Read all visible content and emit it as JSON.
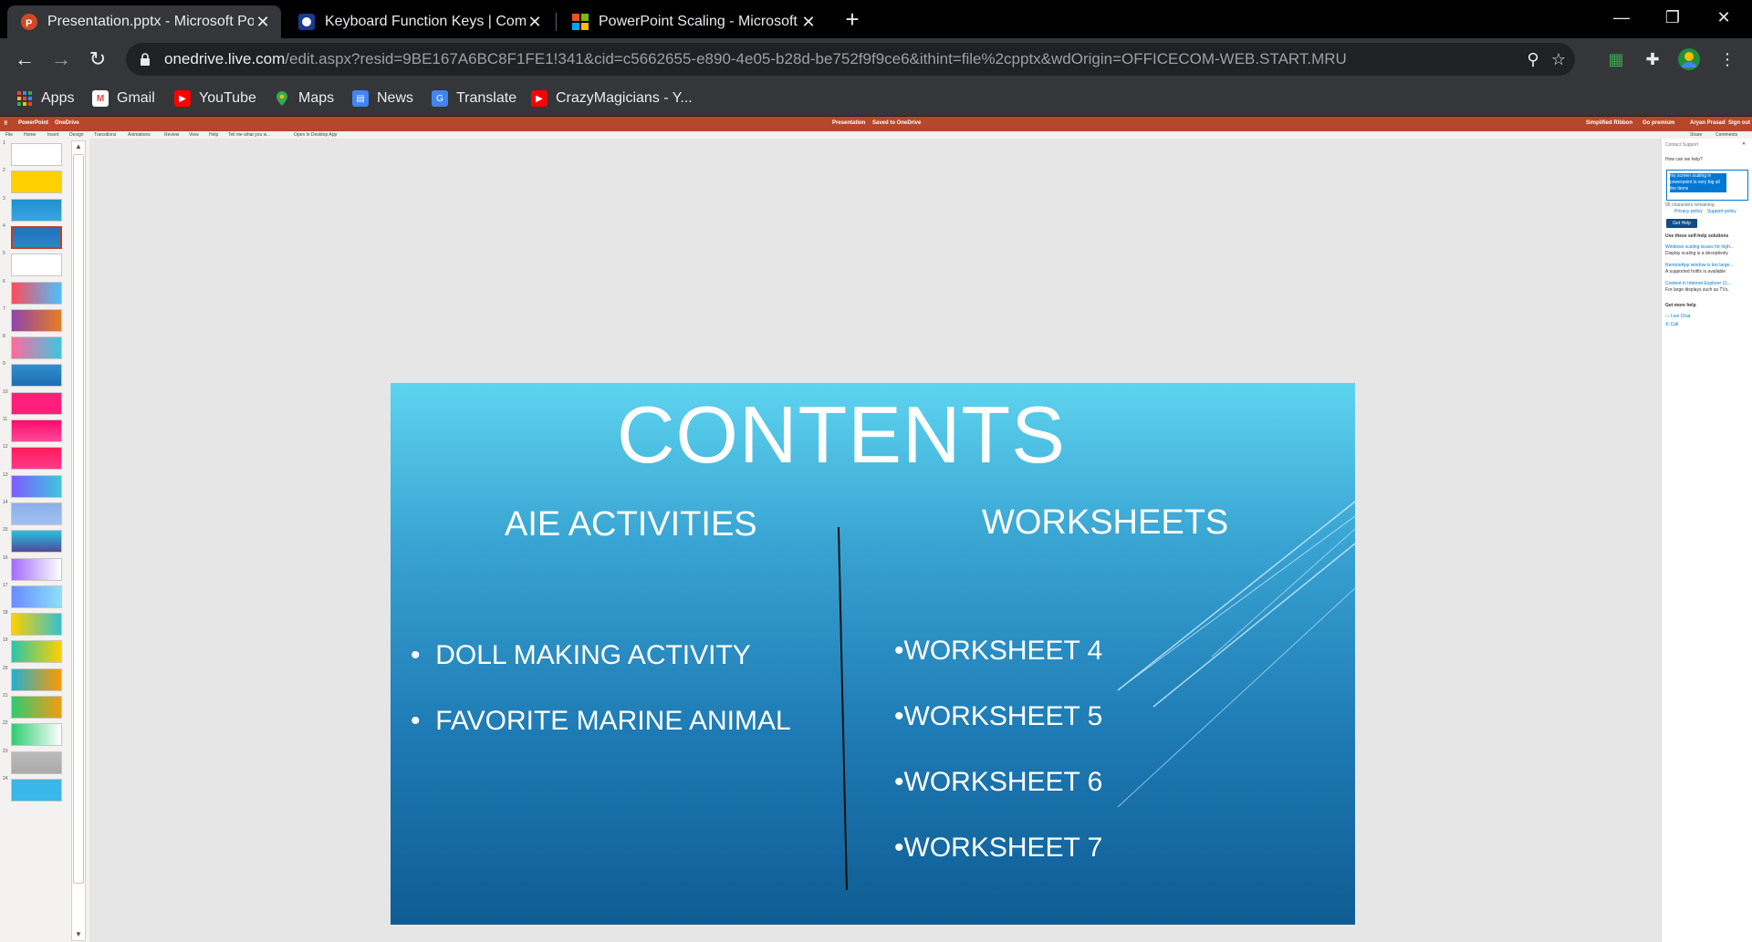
{
  "browser": {
    "tabs": [
      {
        "title": "Presentation.pptx - Microsoft PowerPoint Online",
        "active": true,
        "icon": "powerpoint-icon"
      },
      {
        "title": "Keyboard Function Keys | Computer Hope",
        "active": false,
        "icon": "computer-hope-icon"
      },
      {
        "title": "PowerPoint Scaling - Microsoft Community",
        "active": false,
        "icon": "microsoft-icon"
      }
    ],
    "url_host": "onedrive.live.com",
    "url_path": "/edit.aspx?resid=9BE167A6BC8F1FE1!341&cid=c5662655-e890-4e05-b28d-be752f9f9ce6&ithint=file%2cpptx&wdOrigin=OFFICECOM-WEB.START.MRU",
    "bookmarks": [
      {
        "label": "Apps",
        "icon": "apps-grid-icon"
      },
      {
        "label": "Gmail",
        "icon": "gmail-icon"
      },
      {
        "label": "YouTube",
        "icon": "youtube-icon"
      },
      {
        "label": "Maps",
        "icon": "maps-icon"
      },
      {
        "label": "News",
        "icon": "news-icon"
      },
      {
        "label": "Translate",
        "icon": "translate-icon"
      },
      {
        "label": "CrazyMagicians - Y...",
        "icon": "youtube-icon"
      }
    ]
  },
  "ppt": {
    "titlebar": {
      "app": "PowerPoint",
      "service": "OneDrive",
      "doc": "Presentation",
      "saved": "Saved to OneDrive",
      "simplified": "Simplified Ribbon",
      "premium": "Go premium",
      "user": "Aryan Prasad",
      "signout": "Sign out"
    },
    "menu": [
      "File",
      "Home",
      "Insert",
      "Design",
      "Transitions",
      "Animations",
      "Review",
      "View",
      "Help",
      "Tell me what you w...",
      "Open in Desktop App"
    ],
    "menu_right": [
      "Share",
      "Comments"
    ],
    "slide_count": 24,
    "slide": {
      "title": "CONTENTS",
      "left_heading": "AIE ACTIVITIES",
      "right_heading": "WORKSHEETS",
      "left_bullets": [
        "DOLL MAKING ACTIVITY",
        "FAVORITE MARINE ANIMAL"
      ],
      "right_bullets": [
        "WORKSHEET 4",
        "WORKSHEET 5",
        "WORKSHEET 6",
        "WORKSHEET 7"
      ]
    },
    "help_pane": {
      "title": "Contact Support",
      "question": "How can we help?",
      "input_text": "my screen scaling in powerpoint is very big all the items",
      "char_info": "95 characters remaining",
      "privacy": "Privacy policy",
      "support_policy": "Support policy",
      "get_help": "Get Help",
      "solutions_heading": "Use these self-help solutions",
      "solutions": [
        {
          "link": "Windows scaling issues for high...",
          "desc": "Display scaling is a deceptively"
        },
        {
          "link": "RemoteApp window is too large...",
          "desc": "A supported hotfix is available"
        },
        {
          "link": "Content in Internet Explorer 11...",
          "desc": "For large displays such as TVs,"
        }
      ],
      "more_heading": "Get more help",
      "live_chat": "Live Chat",
      "call": "Call"
    }
  },
  "colors": {
    "ppt_brand": "#b7472a",
    "slide_top": "#5ed4ef",
    "slide_bottom": "#0f5c93",
    "link": "#0078d4"
  }
}
